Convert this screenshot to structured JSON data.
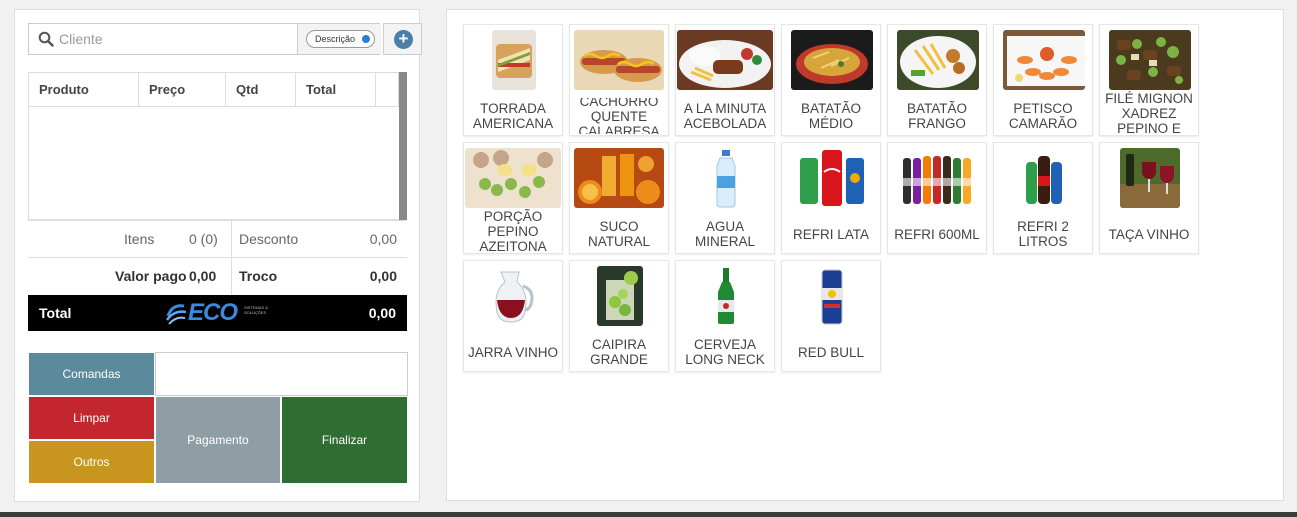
{
  "search": {
    "placeholder": "Cliente",
    "toggle_label": "Descrição"
  },
  "table": {
    "headers": [
      "Produto",
      "Preço",
      "Qtd",
      "Total"
    ]
  },
  "summary": {
    "itens_label": "Itens",
    "itens_value": "0 (0)",
    "desconto_label": "Desconto",
    "desconto_value": "0,00",
    "valor_pago_label": "Valor pago",
    "valor_pago_value": "0,00",
    "troco_label": "Troco",
    "troco_value": "0,00",
    "total_label": "Total",
    "total_value": "0,00"
  },
  "logo": {
    "text": "ECO",
    "tagline": "SISTEMAS & SOLUÇÕES"
  },
  "actions": {
    "comandas": "Comandas",
    "limpar": "Limpar",
    "outros": "Outros",
    "pagamento": "Pagamento",
    "finalizar": "Finalizar"
  },
  "products": [
    {
      "name": "TORRADA AMERICANA",
      "icon": "toast-icon"
    },
    {
      "name": "CACHORRO QUENTE CALABRESA",
      "icon": "hotdog-icon"
    },
    {
      "name": "A LA MINUTA ACEBOLADA",
      "icon": "steak-plate-icon"
    },
    {
      "name": "BATATÃO MÉDIO",
      "icon": "fries-plate-icon"
    },
    {
      "name": "BATATÃO FRANGO",
      "icon": "fries-chicken-icon"
    },
    {
      "name": "PETISCO CAMARÃO",
      "icon": "shrimp-icon"
    },
    {
      "name": "FILÉ MIGNON XADREZ PEPINO E AZEITONA",
      "icon": "beef-stirfry-icon"
    },
    {
      "name": "PORÇÃO PEPINO AZEITONA OVO DE",
      "icon": "pickles-icon"
    },
    {
      "name": "SUCO NATURAL",
      "icon": "juice-icon"
    },
    {
      "name": "AGUA MINERAL",
      "icon": "water-bottle-icon"
    },
    {
      "name": "REFRI LATA",
      "icon": "soda-can-icon"
    },
    {
      "name": "REFRI 600ML",
      "icon": "soda-bottles-icon"
    },
    {
      "name": "REFRI 2 LITROS",
      "icon": "soda-2l-icon"
    },
    {
      "name": "TAÇA VINHO",
      "icon": "wine-glass-icon"
    },
    {
      "name": "JARRA VINHO",
      "icon": "wine-jug-icon"
    },
    {
      "name": "CAIPIRA GRANDE",
      "icon": "caipirinha-icon"
    },
    {
      "name": "CERVEJA LONG NECK",
      "icon": "beer-bottle-icon"
    },
    {
      "name": "RED BULL",
      "icon": "energy-can-icon"
    }
  ]
}
